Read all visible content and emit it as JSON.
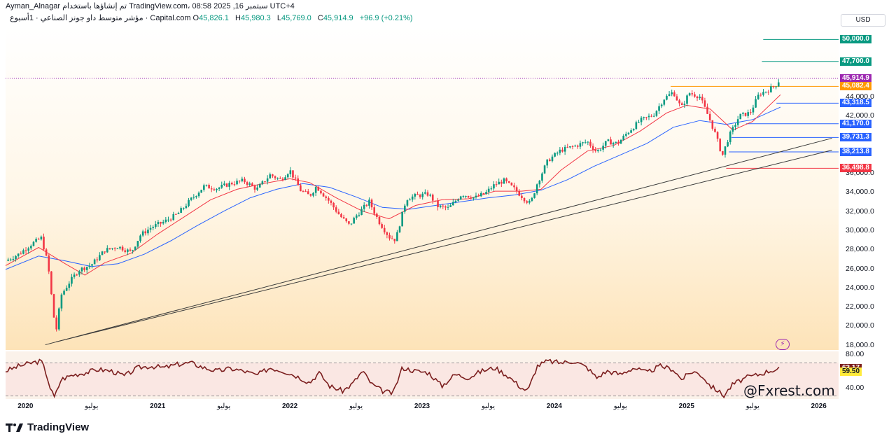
{
  "header": {
    "author_line": "Ayman_Alnagar تم إنشاؤها باستخدام TradingView.com، 08:58 2025 ,16 سبتمبر UTC+4",
    "symbol_line": "مؤشر متوسط داو جونز الصناعي · 1أسبوع · Capital.com",
    "ohlc": {
      "o_label": "O",
      "o": "45,826.1",
      "h_label": "H",
      "h": "45,980.3",
      "l_label": "L",
      "l": "45,769.0",
      "c_label": "C",
      "c": "45,914.9",
      "change": "+96.9 (+0.21%)"
    },
    "currency": "USD"
  },
  "watermark": "@Fxrest.com",
  "brand": "TradingView",
  "colors": {
    "up": "#089981",
    "down": "#f23645",
    "ma_fast": "#f23645",
    "ma_slow": "#2962ff",
    "rsi_line": "#7b1e1e",
    "level_green": "#089981",
    "level_blue": "#2962ff",
    "level_red": "#f23645",
    "level_orange": "#ff9800",
    "price_tag": "#9c27b0"
  },
  "price_tags": [
    {
      "label": "50,000.0",
      "kind": "green"
    },
    {
      "label": "47,700.0",
      "kind": "green"
    },
    {
      "label": "45,914.9",
      "sub": "3d 17h",
      "kind": "price"
    },
    {
      "label": "45,082.4",
      "kind": "orange"
    },
    {
      "label": "43,318.5",
      "kind": "blue"
    },
    {
      "label": "41,170.0",
      "kind": "blue"
    },
    {
      "label": "39,731.3",
      "kind": "blue"
    },
    {
      "label": "38,213.8",
      "kind": "blue"
    },
    {
      "label": "36,498.8",
      "kind": "red"
    }
  ],
  "rsi_tags": [
    {
      "label": "63.17",
      "kind": "rsi"
    },
    {
      "label": "59.50",
      "kind": "rsi_ma"
    }
  ],
  "chart_data": {
    "type": "candlestick",
    "title": "مؤشر متوسط داو جونز الصناعي",
    "timeframe": "1أسبوع",
    "y_axis_labels": [
      "18,000.0",
      "20,000.0",
      "22,000.0",
      "24,000.0",
      "26,000.0",
      "28,000.0",
      "30,000.0",
      "32,000.0",
      "34,000.0",
      "36,000.0",
      "42,000.0",
      "44,000.0"
    ],
    "ylim": [
      17600,
      51200
    ],
    "x_axis_labels": [
      "2020",
      "يوليو",
      "2021",
      "يوليو",
      "2022",
      "يوليو",
      "2023",
      "يوليو",
      "2024",
      "يوليو",
      "2025",
      "يوليو",
      "2026"
    ],
    "x_bold": [
      "2020",
      "2021",
      "2022",
      "2023",
      "2024",
      "2025",
      "2026"
    ],
    "xlim": [
      2019.85,
      2026.15
    ],
    "close_path": [
      [
        2019.85,
        26800
      ],
      [
        2019.95,
        27500
      ],
      [
        2020.05,
        28600
      ],
      [
        2020.12,
        29200
      ],
      [
        2020.17,
        26500
      ],
      [
        2020.21,
        21500
      ],
      [
        2020.23,
        19200
      ],
      [
        2020.27,
        23200
      ],
      [
        2020.33,
        24500
      ],
      [
        2020.4,
        25800
      ],
      [
        2020.5,
        26400
      ],
      [
        2020.6,
        27900
      ],
      [
        2020.7,
        28300
      ],
      [
        2020.8,
        27700
      ],
      [
        2020.87,
        29500
      ],
      [
        2020.95,
        30300
      ],
      [
        2021.05,
        30900
      ],
      [
        2021.15,
        31700
      ],
      [
        2021.25,
        33200
      ],
      [
        2021.35,
        34600
      ],
      [
        2021.45,
        34400
      ],
      [
        2021.55,
        34900
      ],
      [
        2021.65,
        35200
      ],
      [
        2021.75,
        34300
      ],
      [
        2021.85,
        35800
      ],
      [
        2021.93,
        35300
      ],
      [
        2022.0,
        36300
      ],
      [
        2022.08,
        34200
      ],
      [
        2022.15,
        33600
      ],
      [
        2022.2,
        34600
      ],
      [
        2022.3,
        33000
      ],
      [
        2022.38,
        31500
      ],
      [
        2022.45,
        30500
      ],
      [
        2022.5,
        31500
      ],
      [
        2022.6,
        33000
      ],
      [
        2022.67,
        31000
      ],
      [
        2022.75,
        29300
      ],
      [
        2022.8,
        29000
      ],
      [
        2022.88,
        33300
      ],
      [
        2022.95,
        33600
      ],
      [
        2023.05,
        33800
      ],
      [
        2023.12,
        32500
      ],
      [
        2023.2,
        32300
      ],
      [
        2023.3,
        33800
      ],
      [
        2023.4,
        33400
      ],
      [
        2023.48,
        33900
      ],
      [
        2023.55,
        34800
      ],
      [
        2023.62,
        35200
      ],
      [
        2023.7,
        34300
      ],
      [
        2023.78,
        33200
      ],
      [
        2023.82,
        32800
      ],
      [
        2023.87,
        34900
      ],
      [
        2023.95,
        37300
      ],
      [
        2024.05,
        38400
      ],
      [
        2024.15,
        38800
      ],
      [
        2024.25,
        39300
      ],
      [
        2024.32,
        38200
      ],
      [
        2024.4,
        39300
      ],
      [
        2024.48,
        39100
      ],
      [
        2024.55,
        40200
      ],
      [
        2024.65,
        41500
      ],
      [
        2024.75,
        42100
      ],
      [
        2024.83,
        43800
      ],
      [
        2024.9,
        44500
      ],
      [
        2024.96,
        42800
      ],
      [
        2025.02,
        44400
      ],
      [
        2025.1,
        44000
      ],
      [
        2025.17,
        41800
      ],
      [
        2025.22,
        40000
      ],
      [
        2025.27,
        37800
      ],
      [
        2025.32,
        39800
      ],
      [
        2025.4,
        42000
      ],
      [
        2025.48,
        42300
      ],
      [
        2025.55,
        44300
      ],
      [
        2025.62,
        44700
      ],
      [
        2025.68,
        45300
      ],
      [
        2025.71,
        45915
      ]
    ],
    "ma_fast_path": [
      [
        2019.85,
        26300
      ],
      [
        2020.1,
        28200
      ],
      [
        2020.3,
        26500
      ],
      [
        2020.45,
        25300
      ],
      [
        2020.6,
        26600
      ],
      [
        2020.8,
        27600
      ],
      [
        2021.0,
        29600
      ],
      [
        2021.2,
        31400
      ],
      [
        2021.4,
        33200
      ],
      [
        2021.6,
        34300
      ],
      [
        2021.8,
        34900
      ],
      [
        2022.0,
        35400
      ],
      [
        2022.15,
        35000
      ],
      [
        2022.35,
        33400
      ],
      [
        2022.55,
        32000
      ],
      [
        2022.75,
        31200
      ],
      [
        2022.95,
        32600
      ],
      [
        2023.15,
        33200
      ],
      [
        2023.35,
        33300
      ],
      [
        2023.55,
        34100
      ],
      [
        2023.75,
        34100
      ],
      [
        2023.9,
        34300
      ],
      [
        2024.05,
        36300
      ],
      [
        2024.25,
        38300
      ],
      [
        2024.45,
        38900
      ],
      [
        2024.65,
        40400
      ],
      [
        2024.85,
        42300
      ],
      [
        2025.0,
        43100
      ],
      [
        2025.18,
        42700
      ],
      [
        2025.35,
        40500
      ],
      [
        2025.5,
        41400
      ],
      [
        2025.65,
        43400
      ],
      [
        2025.71,
        44200
      ]
    ],
    "ma_slow_path": [
      [
        2019.85,
        25900
      ],
      [
        2020.1,
        27300
      ],
      [
        2020.3,
        26800
      ],
      [
        2020.5,
        26200
      ],
      [
        2020.7,
        26500
      ],
      [
        2020.9,
        27500
      ],
      [
        2021.1,
        28900
      ],
      [
        2021.3,
        30500
      ],
      [
        2021.5,
        32000
      ],
      [
        2021.7,
        33400
      ],
      [
        2021.9,
        34300
      ],
      [
        2022.1,
        34900
      ],
      [
        2022.3,
        34500
      ],
      [
        2022.5,
        33500
      ],
      [
        2022.7,
        32400
      ],
      [
        2022.9,
        32200
      ],
      [
        2023.1,
        32600
      ],
      [
        2023.3,
        33000
      ],
      [
        2023.5,
        33400
      ],
      [
        2023.7,
        33700
      ],
      [
        2023.9,
        34200
      ],
      [
        2024.1,
        35300
      ],
      [
        2024.3,
        36700
      ],
      [
        2024.5,
        37900
      ],
      [
        2024.7,
        39100
      ],
      [
        2024.9,
        40800
      ],
      [
        2025.1,
        41500
      ],
      [
        2025.3,
        41100
      ],
      [
        2025.5,
        41600
      ],
      [
        2025.71,
        42900
      ]
    ],
    "levels": [
      {
        "value": 50000,
        "from": 2025.58,
        "color": "green"
      },
      {
        "value": 47700,
        "from": 2025.57,
        "color": "green"
      },
      {
        "value": 45082.4,
        "from": 2024.88,
        "color": "orange"
      },
      {
        "value": 43318.5,
        "from": 2025.68,
        "color": "blue"
      },
      {
        "value": 41170.0,
        "from": 2025.45,
        "color": "blue"
      },
      {
        "value": 39731.3,
        "from": 2025.34,
        "color": "blue"
      },
      {
        "value": 38213.8,
        "from": 2025.32,
        "color": "blue"
      },
      {
        "value": 36498.8,
        "from": 2025.3,
        "color": "red"
      }
    ],
    "trendlines": [
      {
        "from": [
          2020.15,
          18000
        ],
        "to": [
          2026.1,
          39650
        ]
      },
      {
        "from": [
          2020.23,
          18300
        ],
        "to": [
          2026.1,
          38400
        ]
      }
    ],
    "rsi": {
      "axis_labels": [
        "80.00",
        "40.00"
      ],
      "ylim": [
        28,
        82
      ],
      "bands": [
        70,
        30
      ],
      "current": 63.17,
      "ma": 59.5,
      "path": [
        [
          2019.85,
          60
        ],
        [
          2019.95,
          66
        ],
        [
          2020.05,
          70
        ],
        [
          2020.12,
          72
        ],
        [
          2020.16,
          56
        ],
        [
          2020.19,
          38
        ],
        [
          2020.22,
          28
        ],
        [
          2020.27,
          50
        ],
        [
          2020.35,
          55
        ],
        [
          2020.45,
          58
        ],
        [
          2020.55,
          62
        ],
        [
          2020.65,
          60
        ],
        [
          2020.75,
          54
        ],
        [
          2020.85,
          64
        ],
        [
          2020.95,
          66
        ],
        [
          2021.05,
          64
        ],
        [
          2021.15,
          68
        ],
        [
          2021.25,
          70
        ],
        [
          2021.35,
          64
        ],
        [
          2021.45,
          60
        ],
        [
          2021.55,
          63
        ],
        [
          2021.65,
          60
        ],
        [
          2021.75,
          55
        ],
        [
          2021.85,
          64
        ],
        [
          2021.95,
          60
        ],
        [
          2022.05,
          54
        ],
        [
          2022.15,
          46
        ],
        [
          2022.22,
          58
        ],
        [
          2022.3,
          42
        ],
        [
          2022.4,
          36
        ],
        [
          2022.47,
          44
        ],
        [
          2022.55,
          60
        ],
        [
          2022.62,
          44
        ],
        [
          2022.7,
          36
        ],
        [
          2022.78,
          33
        ],
        [
          2022.85,
          64
        ],
        [
          2022.95,
          60
        ],
        [
          2023.05,
          58
        ],
        [
          2023.15,
          42
        ],
        [
          2023.25,
          56
        ],
        [
          2023.35,
          52
        ],
        [
          2023.45,
          60
        ],
        [
          2023.55,
          64
        ],
        [
          2023.65,
          54
        ],
        [
          2023.75,
          40
        ],
        [
          2023.8,
          36
        ],
        [
          2023.87,
          66
        ],
        [
          2023.95,
          72
        ],
        [
          2024.05,
          70
        ],
        [
          2024.15,
          72
        ],
        [
          2024.25,
          64
        ],
        [
          2024.32,
          52
        ],
        [
          2024.4,
          60
        ],
        [
          2024.5,
          56
        ],
        [
          2024.6,
          64
        ],
        [
          2024.7,
          58
        ],
        [
          2024.8,
          66
        ],
        [
          2024.9,
          62
        ],
        [
          2024.96,
          50
        ],
        [
          2025.05,
          60
        ],
        [
          2025.12,
          54
        ],
        [
          2025.18,
          42
        ],
        [
          2025.24,
          36
        ],
        [
          2025.28,
          30
        ],
        [
          2025.35,
          44
        ],
        [
          2025.45,
          52
        ],
        [
          2025.55,
          56
        ],
        [
          2025.62,
          60
        ],
        [
          2025.71,
          63.17
        ]
      ]
    }
  }
}
